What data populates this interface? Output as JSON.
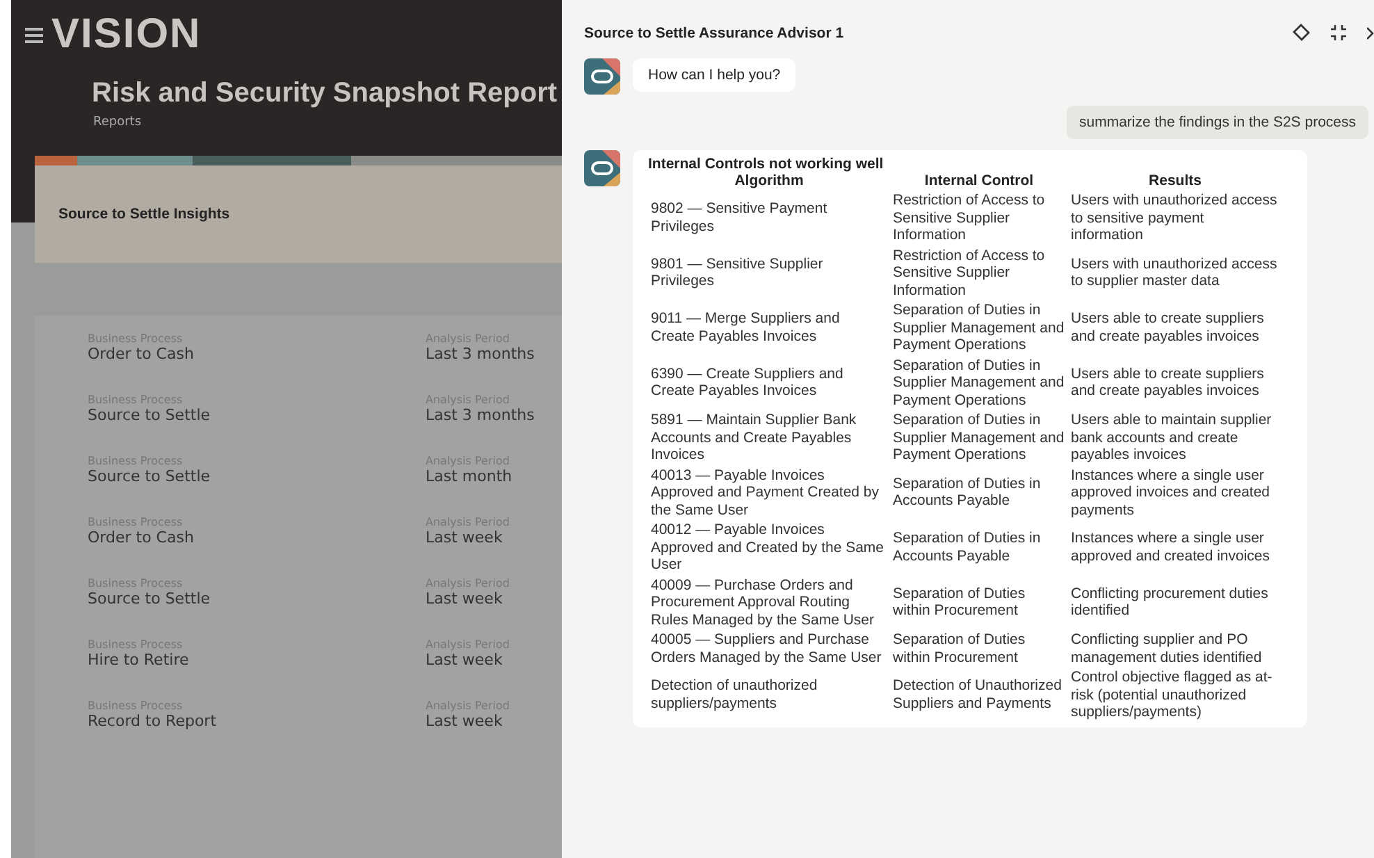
{
  "app": {
    "logo": "VISION",
    "title": "Risk and Security Snapshot Report",
    "breadcrumb": "Reports"
  },
  "card": {
    "title": "Source to Settle Insights",
    "items": [
      {
        "process_label": "Business Process",
        "process": "Order to Cash",
        "period_label": "Analysis Period",
        "period": "Last 3 months"
      },
      {
        "process_label": "Business Process",
        "process": "Source to Settle",
        "period_label": "Analysis Period",
        "period": "Last 3 months"
      },
      {
        "process_label": "Business Process",
        "process": "Source to Settle",
        "period_label": "Analysis Period",
        "period": "Last month"
      },
      {
        "process_label": "Business Process",
        "process": "Order to Cash",
        "period_label": "Analysis Period",
        "period": "Last week"
      },
      {
        "process_label": "Business Process",
        "process": "Source to Settle",
        "period_label": "Analysis Period",
        "period": "Last week"
      },
      {
        "process_label": "Business Process",
        "process": "Hire to Retire",
        "period_label": "Analysis Period",
        "period": "Last week"
      },
      {
        "process_label": "Business Process",
        "process": "Record to Report",
        "period_label": "Analysis Period",
        "period": "Last week"
      }
    ]
  },
  "chat": {
    "title": "Source to Settle Assurance Advisor 1",
    "messages": [
      {
        "kind": "bot",
        "text": "How can I help you?"
      },
      {
        "kind": "user",
        "text": "summarize the findings in the S2S process"
      },
      {
        "kind": "table",
        "title": "Internal Controls not working well",
        "columns": [
          "Algorithm",
          "Internal Control",
          "Results"
        ],
        "rows": [
          [
            "9802 — Sensitive Payment Privileges",
            "Restriction of Access to Sensitive Supplier Information",
            "Users with unauthorized access to sensitive payment information"
          ],
          [
            "9801 — Sensitive Supplier Privileges",
            "Restriction of Access to Sensitive Supplier Information",
            "Users with unauthorized access to supplier master data"
          ],
          [
            "9011 — Merge Suppliers and Create Payables Invoices",
            "Separation of Duties in Supplier Management and Payment Operations",
            "Users able to create suppliers and create payables invoices"
          ],
          [
            "6390 — Create Suppliers and Create Payables Invoices",
            "Separation of Duties in Supplier Management and Payment Operations",
            "Users able to create suppliers and create payables invoices"
          ],
          [
            "5891 — Maintain Supplier Bank Accounts and Create Payables Invoices",
            "Separation of Duties in Supplier Management and Payment Operations",
            "Users able to maintain supplier bank accounts and create payables invoices"
          ],
          [
            "40013 — Payable Invoices Approved and Payment Created by the Same User",
            "Separation of Duties in Accounts Payable",
            "Instances where a single user approved invoices and created payments"
          ],
          [
            "40012 — Payable Invoices Approved and Created by the Same User",
            "Separation of Duties in Accounts Payable",
            "Instances where a single user approved and created invoices"
          ],
          [
            "40009 — Purchase Orders and Procurement Approval Routing Rules Managed by the Same User",
            "Separation of Duties within Procurement",
            "Conflicting procurement duties identified"
          ],
          [
            "40005 — Suppliers and Purchase Orders Managed by the Same User",
            "Separation of Duties within Procurement",
            "Conflicting supplier and PO management duties identified"
          ],
          [
            "Detection of unauthorized suppliers/payments",
            "Detection of Unauthorized Suppliers and Payments",
            "Control objective flagged as at-risk (potential unauthorized suppliers/payments)"
          ]
        ]
      }
    ]
  }
}
